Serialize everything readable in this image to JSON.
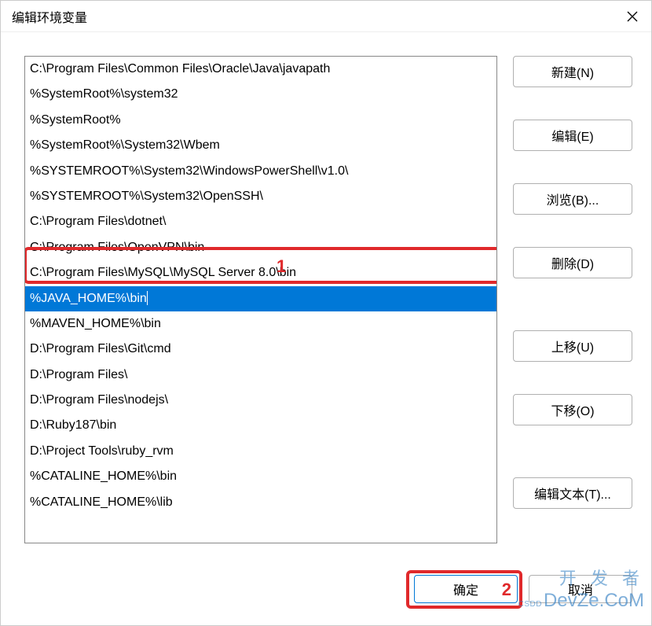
{
  "window": {
    "title": "编辑环境变量"
  },
  "list": {
    "items": [
      {
        "value": "C:\\Program Files\\Common Files\\Oracle\\Java\\javapath",
        "selected": false
      },
      {
        "value": "%SystemRoot%\\system32",
        "selected": false
      },
      {
        "value": "%SystemRoot%",
        "selected": false
      },
      {
        "value": "%SystemRoot%\\System32\\Wbem",
        "selected": false
      },
      {
        "value": "%SYSTEMROOT%\\System32\\WindowsPowerShell\\v1.0\\",
        "selected": false
      },
      {
        "value": "%SYSTEMROOT%\\System32\\OpenSSH\\",
        "selected": false
      },
      {
        "value": "C:\\Program Files\\dotnet\\",
        "selected": false
      },
      {
        "value": "C:\\Program Files\\OpenVPN\\bin",
        "selected": false
      },
      {
        "value": "C:\\Program Files\\MySQL\\MySQL Server 8.0\\bin",
        "selected": false
      },
      {
        "value": "%JAVA_HOME%\\bin",
        "selected": true
      },
      {
        "value": "%MAVEN_HOME%\\bin",
        "selected": false
      },
      {
        "value": "D:\\Program Files\\Git\\cmd",
        "selected": false
      },
      {
        "value": "D:\\Program Files\\",
        "selected": false
      },
      {
        "value": "D:\\Program Files\\nodejs\\",
        "selected": false
      },
      {
        "value": "D:\\Ruby187\\bin",
        "selected": false
      },
      {
        "value": "D:\\Project Tools\\ruby_rvm",
        "selected": false
      },
      {
        "value": "%CATALINE_HOME%\\bin",
        "selected": false
      },
      {
        "value": "%CATALINE_HOME%\\lib",
        "selected": false
      }
    ]
  },
  "buttons": {
    "new": "新建(N)",
    "edit": "编辑(E)",
    "browse": "浏览(B)...",
    "delete": "删除(D)",
    "moveUp": "上移(U)",
    "moveDown": "下移(O)",
    "editText": "编辑文本(T)..."
  },
  "footer": {
    "ok": "确定",
    "cancel": "取消"
  },
  "annotations": {
    "num1": "1",
    "num2": "2"
  },
  "watermark": {
    "line1": "开 发 者",
    "prefix": "CSDD",
    "main": "DevZe.CoM"
  }
}
